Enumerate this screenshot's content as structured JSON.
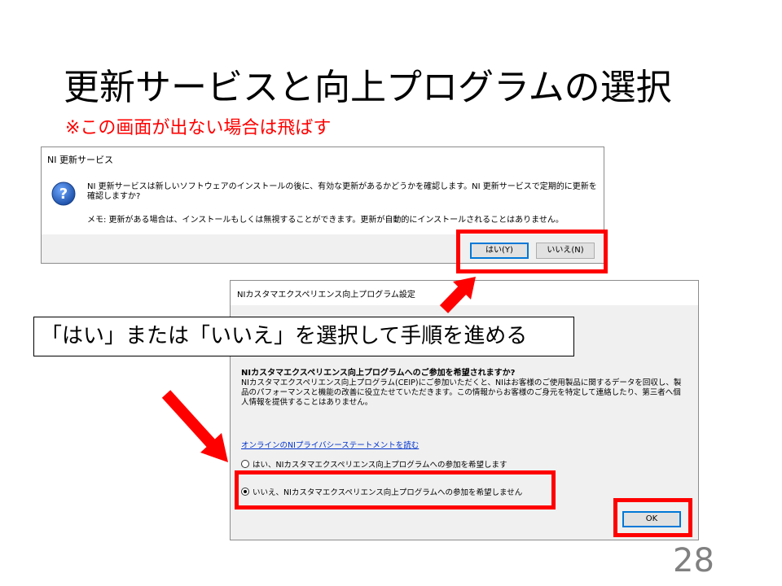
{
  "slide": {
    "title": "更新サービスと向上プログラムの選択",
    "note": "※この画面が出ない場合は飛ばす",
    "callout": "「はい」または「いいえ」を選択して手順を進める",
    "page_number": "28"
  },
  "update_dialog": {
    "title": "NI 更新サービス",
    "icon": "question-icon",
    "message": "NI 更新サービスは新しいソフトウェアのインストールの後に、有効な更新があるかどうかを確認します。NI 更新サービスで定期的に更新を確認しますか?",
    "memo": "メモ: 更新がある場合は、インストールもしくは無視することができます。更新が自動的にインストールされることはありません。",
    "yes_button": "はい(Y)",
    "no_button": "いいえ(N)"
  },
  "ceip_dialog": {
    "title": "NIカスタマエクスペリエンス向上プログラム設定",
    "heading": "NIカスタマエクスペリエンス向上プログラムへのご参加を希望されますか?",
    "body": "NIカスタマエクスペリエンス向上プログラム(CEIP)にご参加いただくと、NIはお客様のご使用製品に関するデータを回収し、製品のパフォーマンスと機能の改善に役立たせていただきます。この情報からお客様のご身元を特定して連絡したり、第三者へ個人情報を提供することはありません。",
    "privacy_link": "オンラインのNIプライバシーステートメントを読む",
    "option_yes": "はい、NIカスタマエクスペリエンス向上プログラムへの参加を希望します",
    "option_no": "いいえ、NIカスタマエクスペリエンス向上プログラムへの参加を希望しません",
    "selected_option": "no",
    "ok_button": "OK"
  },
  "colors": {
    "highlight": "#ff0000",
    "link": "#0033cc",
    "dialog_footer": "#f0f0f0"
  }
}
